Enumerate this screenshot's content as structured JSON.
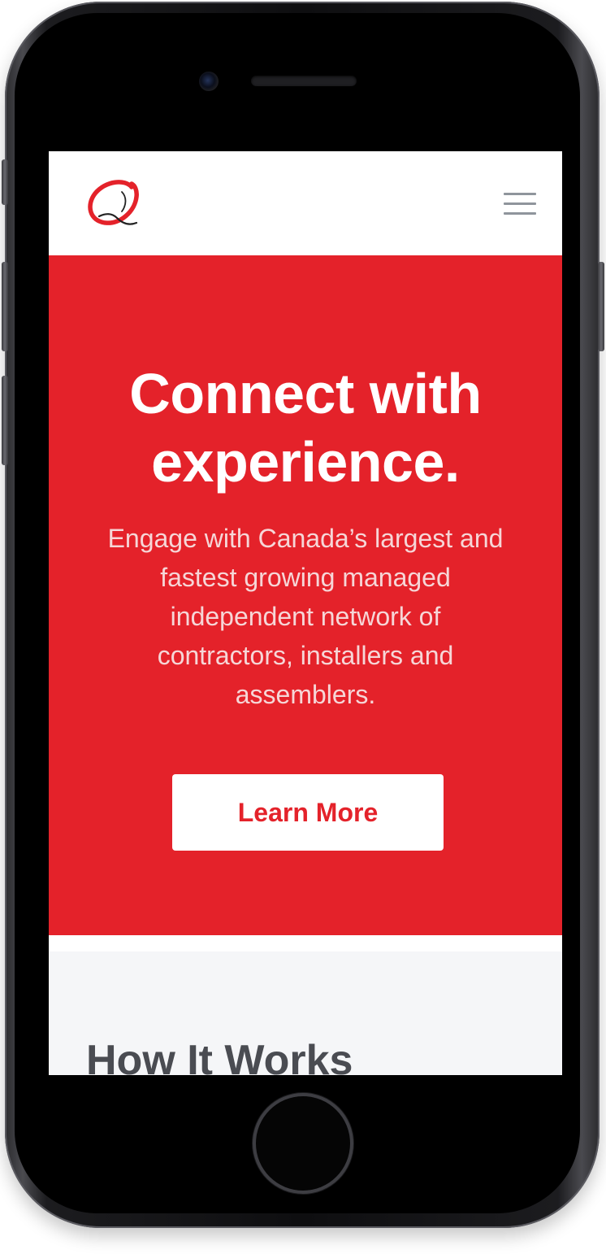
{
  "device": {
    "model": "iPhone",
    "frame_color": "#1c1c1f"
  },
  "header": {
    "logo_icon": "q-logo-icon",
    "menu_icon": "hamburger-menu-icon"
  },
  "hero": {
    "title": "Connect with experience.",
    "subtitle": "Engage with Canada’s largest and fastest growing managed independent network of contractors, installers and assemblers.",
    "cta_label": "Learn More",
    "background_color": "#e4222a"
  },
  "how_it_works": {
    "title": "How It Works",
    "background_color": "#f5f6f8"
  },
  "colors": {
    "brand_red": "#e4222a",
    "menu_icon": "#8f959c",
    "heading_dark": "#4a4c52"
  }
}
